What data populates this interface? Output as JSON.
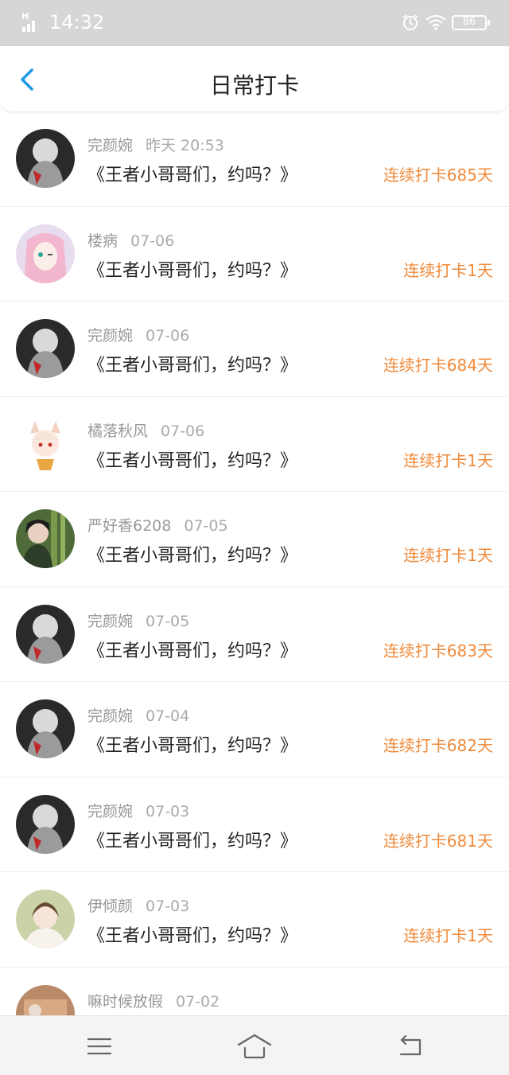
{
  "status_bar": {
    "network": "H",
    "time": "14:32",
    "battery": "86",
    "icons": [
      "signal-icon",
      "alarm-icon",
      "wifi-icon",
      "battery-icon"
    ]
  },
  "header": {
    "title": "日常打卡",
    "back_icon": "chevron-left-icon",
    "accent_color": "#1e9ae6"
  },
  "checkins": [
    {
      "user": "完颜婉",
      "date": "昨天 20:53",
      "title": "《王者小哥哥们，约吗？》",
      "streak": "连续打卡685天",
      "avatar": "dark"
    },
    {
      "user": "楼病",
      "date": "07-06",
      "title": "《王者小哥哥们，约吗？》",
      "streak": "连续打卡1天",
      "avatar": "pink"
    },
    {
      "user": "完颜婉",
      "date": "07-06",
      "title": "《王者小哥哥们，约吗？》",
      "streak": "连续打卡684天",
      "avatar": "dark"
    },
    {
      "user": "橘落秋风",
      "date": "07-06",
      "title": "《王者小哥哥们，约吗？》",
      "streak": "连续打卡1天",
      "avatar": "chibi"
    },
    {
      "user": "严好香6208",
      "date": "07-05",
      "title": "《王者小哥哥们，约吗？》",
      "streak": "连续打卡1天",
      "avatar": "green"
    },
    {
      "user": "完颜婉",
      "date": "07-05",
      "title": "《王者小哥哥们，约吗？》",
      "streak": "连续打卡683天",
      "avatar": "dark"
    },
    {
      "user": "完颜婉",
      "date": "07-04",
      "title": "《王者小哥哥们，约吗？》",
      "streak": "连续打卡682天",
      "avatar": "dark"
    },
    {
      "user": "完颜婉",
      "date": "07-03",
      "title": "《王者小哥哥们，约吗？》",
      "streak": "连续打卡681天",
      "avatar": "dark"
    },
    {
      "user": "伊倾颜",
      "date": "07-03",
      "title": "《王者小哥哥们，约吗？》",
      "streak": "连续打卡1天",
      "avatar": "light"
    },
    {
      "user": "嘛时候放假",
      "date": "07-02",
      "title": "",
      "streak": "",
      "avatar": "brown"
    }
  ],
  "colors": {
    "streak": "#f08a3a",
    "meta": "#999999",
    "status_bar": "#d6d6d6"
  },
  "bottom_nav": [
    "menu-icon",
    "home-icon",
    "back-arrow-icon"
  ]
}
